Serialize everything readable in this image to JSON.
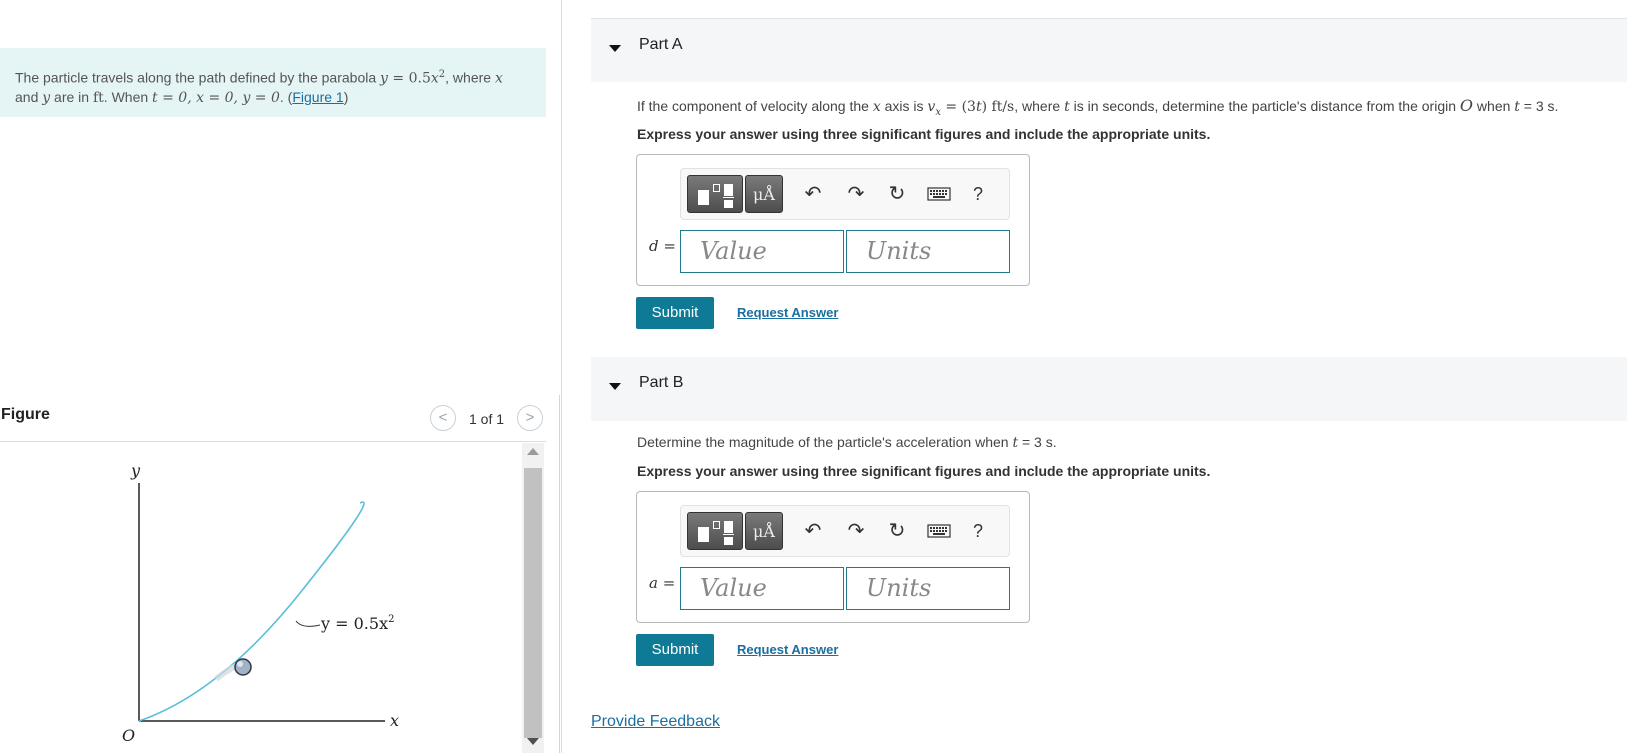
{
  "problem": {
    "text_1": "The particle travels along the path defined by the parabola ",
    "eq_y": "y",
    "eq_eq": " = 0.5",
    "eq_x": "x",
    "eq_sup": "2",
    "text_2": ", where ",
    "var_x": "x",
    "text_3": "and ",
    "var_y": "y",
    "text_4": " are in ",
    "unit_ft": "ft",
    "text_5": ". When ",
    "cond": "t = 0, x = 0, y = 0",
    "text_6": ". (",
    "figure_link": "Figure 1",
    "text_7": ")"
  },
  "figure": {
    "title": "Figure",
    "prev": "<",
    "next": ">",
    "counter": "1 of 1",
    "y_axis": "y",
    "x_axis": "x",
    "origin": "O",
    "curve_label": "y = 0.5x",
    "curve_sup": "2"
  },
  "part_a": {
    "label": "Part A",
    "question_1": "If the component of velocity along the ",
    "q_x": "x",
    "question_2": " axis is ",
    "q_vx": "v",
    "q_vx_sub": "x",
    "q_eq": " = (3",
    "q_t": "t",
    "q_close": ")",
    "q_unit": " ft/s",
    "question_3": ", where ",
    "q_t2": "t",
    "question_4": " is in seconds, determine the particle's distance from the origin ",
    "q_O": "O",
    "question_5": " when ",
    "q_t3": "t",
    "question_6": " = 3 s.",
    "instruction": "Express your answer using three significant figures and include the appropriate units.",
    "variable": "d",
    "value_placeholder": "Value",
    "units_placeholder": "Units",
    "submit": "Submit",
    "request": "Request Answer"
  },
  "part_b": {
    "label": "Part B",
    "question_1": "Determine the magnitude of the particle's acceleration when ",
    "q_t": "t",
    "question_2": " = 3 s.",
    "instruction": "Express your answer using three significant figures and include the appropriate units.",
    "variable": "a",
    "value_placeholder": "Value",
    "units_placeholder": "Units",
    "submit": "Submit",
    "request": "Request Answer"
  },
  "toolbar": {
    "units_btn": "μÅ",
    "undo": "↶",
    "redo": "↷",
    "reset": "↻",
    "help": "?"
  },
  "feedback": "Provide Feedback",
  "colors": {
    "accent": "#0f7a95",
    "link": "#1a6fa0",
    "problem_bg": "#e5f4f5",
    "curve": "#5bbfd9"
  }
}
